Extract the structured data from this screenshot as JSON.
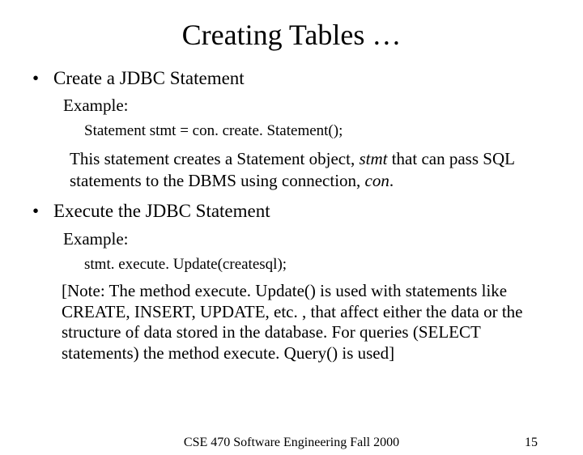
{
  "title": "Creating Tables …",
  "bullets": {
    "b1": {
      "dot": "•",
      "text": "Create a JDBC Statement",
      "exampleLabel": "Example:",
      "code": "Statement stmt = con. create. Statement();",
      "explain_pre": "This statement creates a Statement object, ",
      "explain_stmt": "stmt",
      "explain_mid": " that can pass SQL statements to the DBMS using connection, ",
      "explain_con": "con",
      "explain_post": "."
    },
    "b2": {
      "dot": "•",
      "text": "Execute the JDBC Statement",
      "exampleLabel": "Example:",
      "code": "stmt. execute. Update(createsql);",
      "note": "[Note: The method execute. Update() is used with statements like CREATE, INSERT, UPDATE, etc. , that affect either the data or the structure of data stored in the database.  For queries (SELECT statements) the method execute. Query() is used]"
    }
  },
  "footer": {
    "center": "CSE 470    Software Engineering    Fall 2000",
    "pageNumber": "15"
  }
}
